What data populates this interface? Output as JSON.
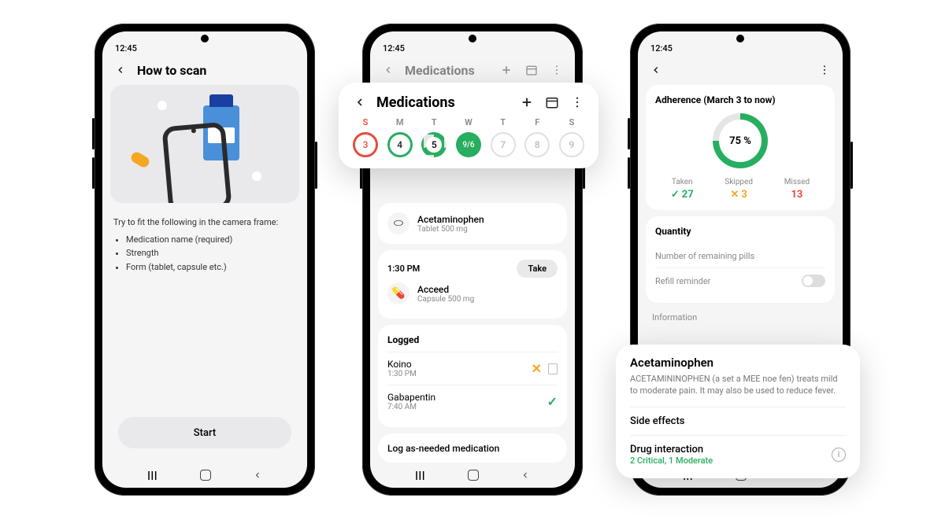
{
  "status_time": "12:45",
  "phone1": {
    "header_title": "How to scan",
    "instr_lead": "Try to fit the following in the camera frame:",
    "instr_items": [
      "Medication name (required)",
      "Strength",
      "Form (tablet, capsule etc.)"
    ],
    "start_label": "Start"
  },
  "phone2": {
    "header_title": "Medications",
    "overlay_title": "Medications",
    "days": [
      {
        "label": "S",
        "num": "3",
        "style": "red"
      },
      {
        "label": "M",
        "num": "4",
        "style": "green"
      },
      {
        "label": "T",
        "num": "5",
        "style": "half"
      },
      {
        "label": "W",
        "num": "9/6",
        "style": "today"
      },
      {
        "label": "T",
        "num": "7",
        "style": "future"
      },
      {
        "label": "F",
        "num": "8",
        "style": "future"
      },
      {
        "label": "S",
        "num": "9",
        "style": "future"
      }
    ],
    "med1": {
      "name": "Acetaminophen",
      "sub": "Tablet 500 mg"
    },
    "slot2": {
      "time": "1:30 PM",
      "take_label": "Take",
      "med_name": "Acceed",
      "med_sub": "Capsule 500 mg"
    },
    "logged_title": "Logged",
    "logged": [
      {
        "name": "Koino",
        "time": "1:30 PM",
        "status": "x"
      },
      {
        "name": "Gabapentin",
        "time": "7:40 AM",
        "status": "check"
      }
    ],
    "log_btn": "Log as-needed medication"
  },
  "phone3": {
    "adh_title": "Adherence (March 3 to now)",
    "ring_pct": "75 %",
    "stats": {
      "taken_l": "Taken",
      "taken_v": "27",
      "skipped_l": "Skipped",
      "skipped_v": "3",
      "missed_l": "Missed",
      "missed_v": "13"
    },
    "qty_title": "Quantity",
    "qty_pills": "Number of remaining pills",
    "qty_refill": "Refill reminder",
    "info_label": "Information",
    "info_overlay": {
      "title": "Acetaminophen",
      "desc": "ACETAMININOPHEN (a set a MEE noe fen) treats mild to moderate pain. It may also be used to reduce fever.",
      "side_effects": "Side effects",
      "drug_int": "Drug interaction",
      "drug_sub": "2 Critical, 1 Moderate"
    }
  },
  "chart_data": {
    "type": "pie",
    "title": "Adherence (March 3 to now)",
    "percentage": 75,
    "series": [
      {
        "name": "Taken",
        "value": 27
      },
      {
        "name": "Skipped",
        "value": 3
      },
      {
        "name": "Missed",
        "value": 13
      }
    ]
  }
}
